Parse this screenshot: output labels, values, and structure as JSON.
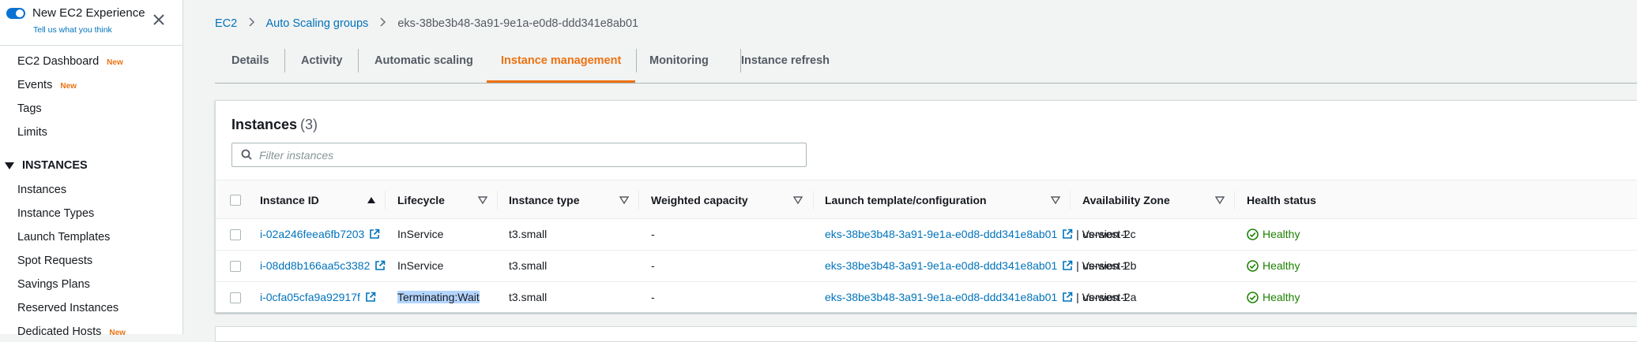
{
  "sidebar": {
    "new_experience_title": "New EC2 Experience",
    "new_experience_link": "Tell us what you think",
    "items": [
      {
        "label": "EC2 Dashboard",
        "badge": "New"
      },
      {
        "label": "Events",
        "badge": "New"
      },
      {
        "label": "Tags",
        "badge": ""
      },
      {
        "label": "Limits",
        "badge": ""
      }
    ],
    "section_label": "INSTANCES",
    "section_items": [
      {
        "label": "Instances",
        "badge": ""
      },
      {
        "label": "Instance Types",
        "badge": ""
      },
      {
        "label": "Launch Templates",
        "badge": ""
      },
      {
        "label": "Spot Requests",
        "badge": ""
      },
      {
        "label": "Savings Plans",
        "badge": ""
      },
      {
        "label": "Reserved Instances",
        "badge": ""
      },
      {
        "label": "Dedicated Hosts",
        "badge": "New"
      }
    ]
  },
  "breadcrumb": {
    "items": [
      "EC2",
      "Auto Scaling groups"
    ],
    "current": "eks-38be3b48-3a91-9e1a-e0d8-ddd341e8ab01"
  },
  "tabs": [
    {
      "label": "Details",
      "active": false
    },
    {
      "label": "Activity",
      "active": false
    },
    {
      "label": "Automatic scaling",
      "active": false
    },
    {
      "label": "Instance management",
      "active": true
    },
    {
      "label": "Monitoring",
      "active": false
    },
    {
      "label": "Instance refresh",
      "active": false
    }
  ],
  "instances_panel": {
    "title": "Instances",
    "count": "(3)",
    "search_placeholder": "Filter instances",
    "columns": [
      "Instance ID",
      "Lifecycle",
      "Instance type",
      "Weighted capacity",
      "Launch template/configuration",
      "Availability Zone",
      "Health status"
    ],
    "rows": [
      {
        "instance_id": "i-02a246feea6fb7203",
        "lifecycle": "InService",
        "instance_type": "t3.small",
        "weighted_capacity": "-",
        "launch_template": "eks-38be3b48-3a91-9e1a-e0d8-ddd341e8ab01",
        "version": "| Version 1",
        "az": "us-west-2c",
        "health": "Healthy"
      },
      {
        "instance_id": "i-08dd8b166aa5c3382",
        "lifecycle": "InService",
        "instance_type": "t3.small",
        "weighted_capacity": "-",
        "launch_template": "eks-38be3b48-3a91-9e1a-e0d8-ddd341e8ab01",
        "version": "| Version 1",
        "az": "us-west-2b",
        "health": "Healthy"
      },
      {
        "instance_id": "i-0cfa05cfa9a92917f",
        "lifecycle": "Terminating:Wait",
        "instance_type": "t3.small",
        "weighted_capacity": "-",
        "launch_template": "eks-38be3b48-3a91-9e1a-e0d8-ddd341e8ab01",
        "version": "| Version 1",
        "az": "us-west-2a",
        "health": "Healthy"
      }
    ]
  },
  "colors": {
    "accent": "#ec7211",
    "link": "#0073bb",
    "healthy": "#1d8102"
  }
}
